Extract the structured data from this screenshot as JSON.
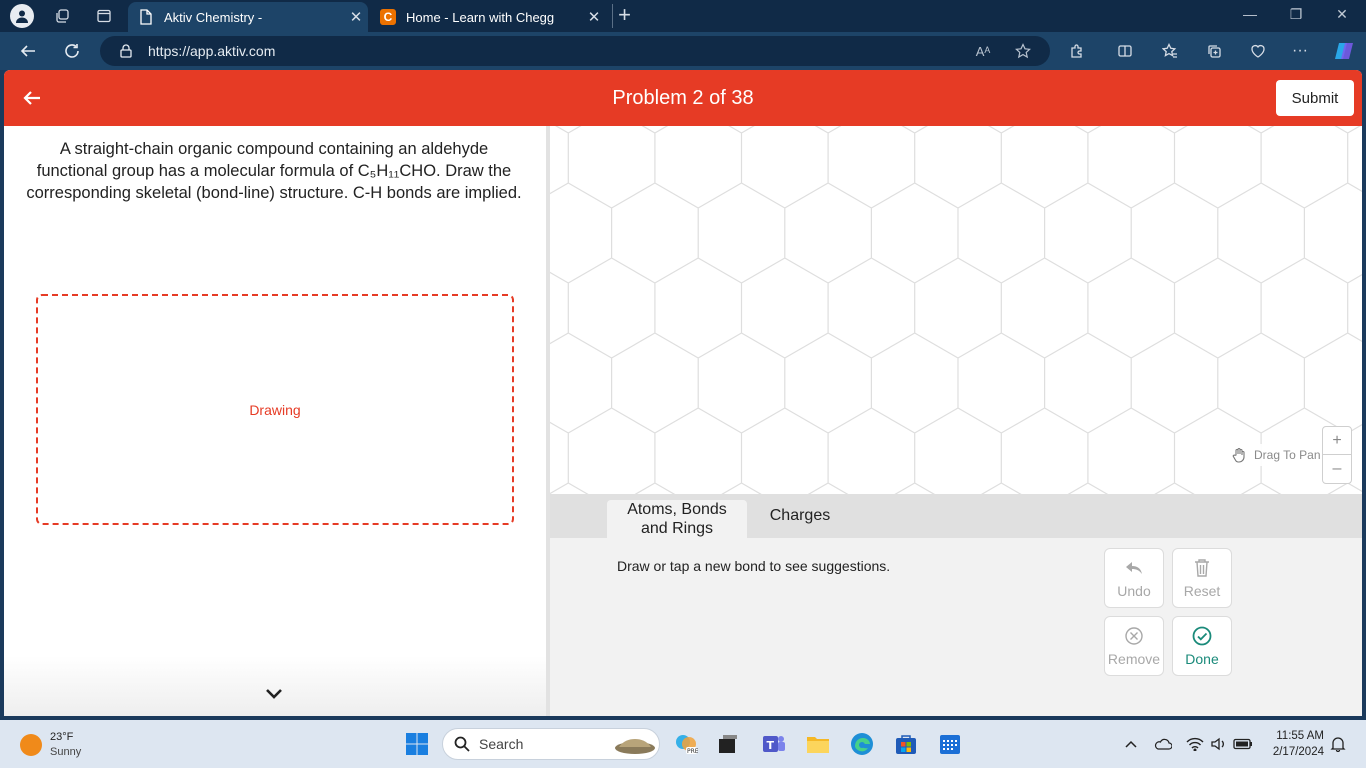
{
  "browser": {
    "tabs": [
      {
        "title": "Aktiv Chemistry -",
        "active": true
      },
      {
        "title": "Home - Learn with Chegg",
        "active": false
      }
    ],
    "chegg_favicon_letter": "C",
    "url": "https://app.aktiv.com",
    "read_aloud_label": "Aᴬ"
  },
  "app": {
    "header_title": "Problem 2 of 38",
    "submit_label": "Submit",
    "accent_color": "#e63b25"
  },
  "question": {
    "text": "A straight-chain organic compound containing an aldehyde functional group has a molecular formula of C₅H₁₁CHO. Draw the corresponding skeletal (bond-line) structure. C-H bonds are implied.",
    "drawing_label": "Drawing"
  },
  "canvas": {
    "drag_to_pan_label": "Drag To Pan",
    "zoom_in_label": "+",
    "zoom_out_label": "–"
  },
  "tools": {
    "tabs": [
      {
        "label_line1": "Atoms, Bonds",
        "label_line2": "and Rings",
        "active": true
      },
      {
        "label": "Charges",
        "active": false
      }
    ],
    "hint": "Draw or tap a new bond to see suggestions.",
    "buttons": {
      "undo": "Undo",
      "reset": "Reset",
      "remove": "Remove",
      "done": "Done"
    }
  },
  "taskbar": {
    "weather_temp": "23°F",
    "weather_condition": "Sunny",
    "search_placeholder": "Search",
    "time": "11:55 AM",
    "date": "2/17/2024"
  }
}
